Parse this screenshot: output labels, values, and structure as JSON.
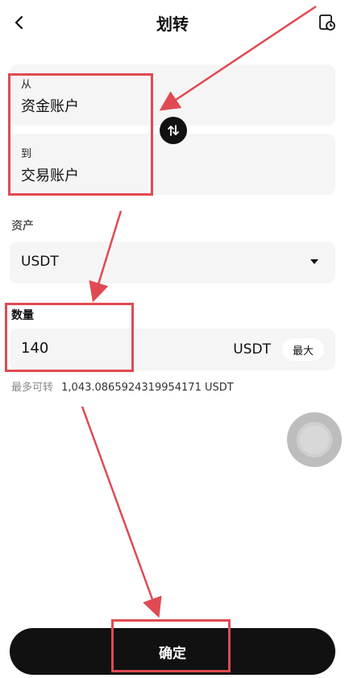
{
  "header": {
    "title": "划转"
  },
  "transfer": {
    "from_label": "从",
    "from_value": "资金账户",
    "to_label": "到",
    "to_value": "交易账户"
  },
  "asset": {
    "label": "资产",
    "value": "USDT"
  },
  "amount": {
    "label": "数量",
    "value": "140",
    "unit": "USDT",
    "max_label": "最大"
  },
  "available": {
    "label": "最多可转",
    "value": "1,043.0865924319954171 USDT"
  },
  "confirm_label": "确定",
  "colors": {
    "accent": "#111111",
    "annotation": "#e04a52",
    "card_bg": "#f5f5f5"
  },
  "icons": {
    "back": "chevron-left-icon",
    "history": "history-icon",
    "swap": "swap-arrows-icon",
    "caret": "caret-down-icon"
  }
}
